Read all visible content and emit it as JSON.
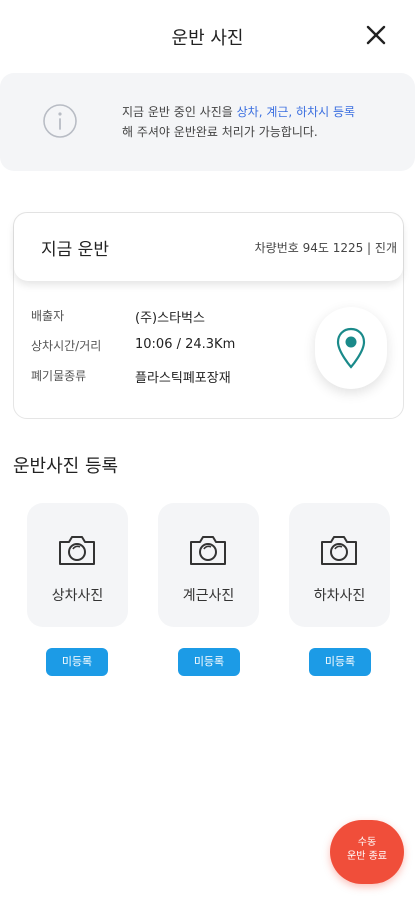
{
  "header": {
    "title": "운반 사진"
  },
  "notice": {
    "text_prefix": "지금 운반 중인 사진을 ",
    "text_highlight": "상차, 계근, 하차시 등록",
    "text_suffix": "해 주셔야 운반완료 처리가 가능합니다."
  },
  "card": {
    "title": "지금 운반",
    "vehicle": "차량번호 94도 1225 | 진개",
    "rows": [
      {
        "label": "배출자",
        "value": "(주)스타벅스"
      },
      {
        "label": "상차시간/거리",
        "value": "10:06 / 24.3Km"
      },
      {
        "label": "폐기물종류",
        "value": "플라스틱폐포장재"
      }
    ]
  },
  "photos": {
    "section_title": "운반사진 등록",
    "tiles": [
      {
        "label": "상차사진",
        "status": "미등록"
      },
      {
        "label": "계근사진",
        "status": "미등록"
      },
      {
        "label": "하차사진",
        "status": "미등록"
      }
    ]
  },
  "fab": {
    "line1": "수동",
    "line2": "운반 종료"
  },
  "colors": {
    "accent": "#1c9be6",
    "highlight": "#3b6fe0",
    "fab": "#f04e3a",
    "pin": "#1a8a8a"
  },
  "icons": {
    "close": "close-icon",
    "info": "info-icon",
    "location": "location-pin-icon",
    "camera": "camera-icon"
  }
}
